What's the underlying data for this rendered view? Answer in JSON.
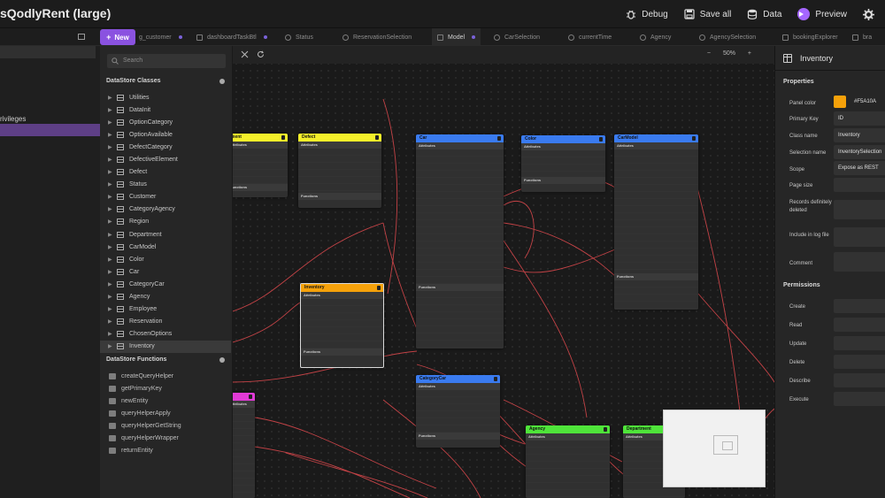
{
  "app": {
    "title": "sQodlyRent (large)"
  },
  "top_actions": [
    {
      "label": "Debug",
      "icon": "bug-icon"
    },
    {
      "label": "Save all",
      "icon": "save-icon"
    },
    {
      "label": "Data",
      "icon": "database-icon"
    },
    {
      "label": "Preview",
      "icon": "play-icon"
    },
    {
      "label": "Settings",
      "icon": "gear-icon"
    }
  ],
  "tabs_bar": {
    "new_label": "New",
    "tabs": [
      {
        "label": "g_customer",
        "icon": "sq"
      },
      {
        "label": "dashboardTaskBtl",
        "icon": "sq"
      },
      {
        "label": "Status",
        "icon": "search"
      },
      {
        "label": "ReservationSelection",
        "icon": "search"
      },
      {
        "label": "Model",
        "icon": "model",
        "active": true
      },
      {
        "label": "CarSelection",
        "icon": "search"
      },
      {
        "label": "currentTime",
        "icon": "search"
      },
      {
        "label": "Agency",
        "icon": "search"
      },
      {
        "label": "AgencySelection",
        "icon": "search"
      },
      {
        "label": "bookingExplorer",
        "icon": "sq"
      },
      {
        "label": "bra",
        "icon": "sq"
      }
    ]
  },
  "left_strip": {
    "items": [
      "rivileges"
    ]
  },
  "sidebar": {
    "search_placeholder": "Search",
    "classes_header": "DataStore Classes",
    "classes": [
      "Utilities",
      "DataInit",
      "OptionCategory",
      "OptionAvailable",
      "DefectCategory",
      "DefectiveElement",
      "Defect",
      "Status",
      "Customer",
      "CategoryAgency",
      "Region",
      "Department",
      "CarModel",
      "Color",
      "Car",
      "CategoryCar",
      "Agency",
      "Employee",
      "Reservation",
      "ChosenOptions",
      "Inventory"
    ],
    "selected_class": "Inventory",
    "functions_header": "DataStore Functions",
    "functions": [
      "createQueryHelper",
      "getPrimaryKey",
      "newEntity",
      "queryHelperApply",
      "queryHelperGetString",
      "queryHelperWrapper",
      "returnEntity"
    ]
  },
  "canvas": {
    "zoom": "50%",
    "zoom_minus": "−",
    "zoom_plus": "+",
    "nodes": [
      {
        "name": "ment",
        "color": "#f4ef2a"
      },
      {
        "name": "Defect",
        "color": "#f4ef2a"
      },
      {
        "name": "Car",
        "color": "#3a7bf0"
      },
      {
        "name": "Color",
        "color": "#3a7bf0"
      },
      {
        "name": "CarModel",
        "color": "#3a7bf0"
      },
      {
        "name": "Inventory",
        "color": "#f5a10a"
      },
      {
        "name": "CategoryCar",
        "color": "#3a7bf0"
      },
      {
        "name": "Agency",
        "color": "#4fe43a"
      },
      {
        "name": "Department",
        "color": "#4fe43a"
      },
      {
        "name": "",
        "color": "#e13ad6"
      }
    ],
    "section_attributes": "Attributes",
    "section_functions": "Functions"
  },
  "properties": {
    "title": "Inventory",
    "section": "Properties",
    "fields": [
      {
        "label": "Panel color",
        "value": "#F5A10A"
      },
      {
        "label": "Primary Key",
        "value": "ID"
      },
      {
        "label": "Class name",
        "value": "Inventory"
      },
      {
        "label": "Selection name",
        "value": "InventorySelection"
      },
      {
        "label": "Scope",
        "value": "Expose as REST"
      },
      {
        "label": "Page size",
        "value": ""
      },
      {
        "label": "Records definitely deleted",
        "value": ""
      },
      {
        "label": "Include in log file",
        "value": ""
      },
      {
        "label": "Comment",
        "value": ""
      }
    ],
    "permissions_header": "Permissions",
    "permissions": [
      "Create",
      "Read",
      "Update",
      "Delete",
      "Describe",
      "Execute"
    ]
  }
}
